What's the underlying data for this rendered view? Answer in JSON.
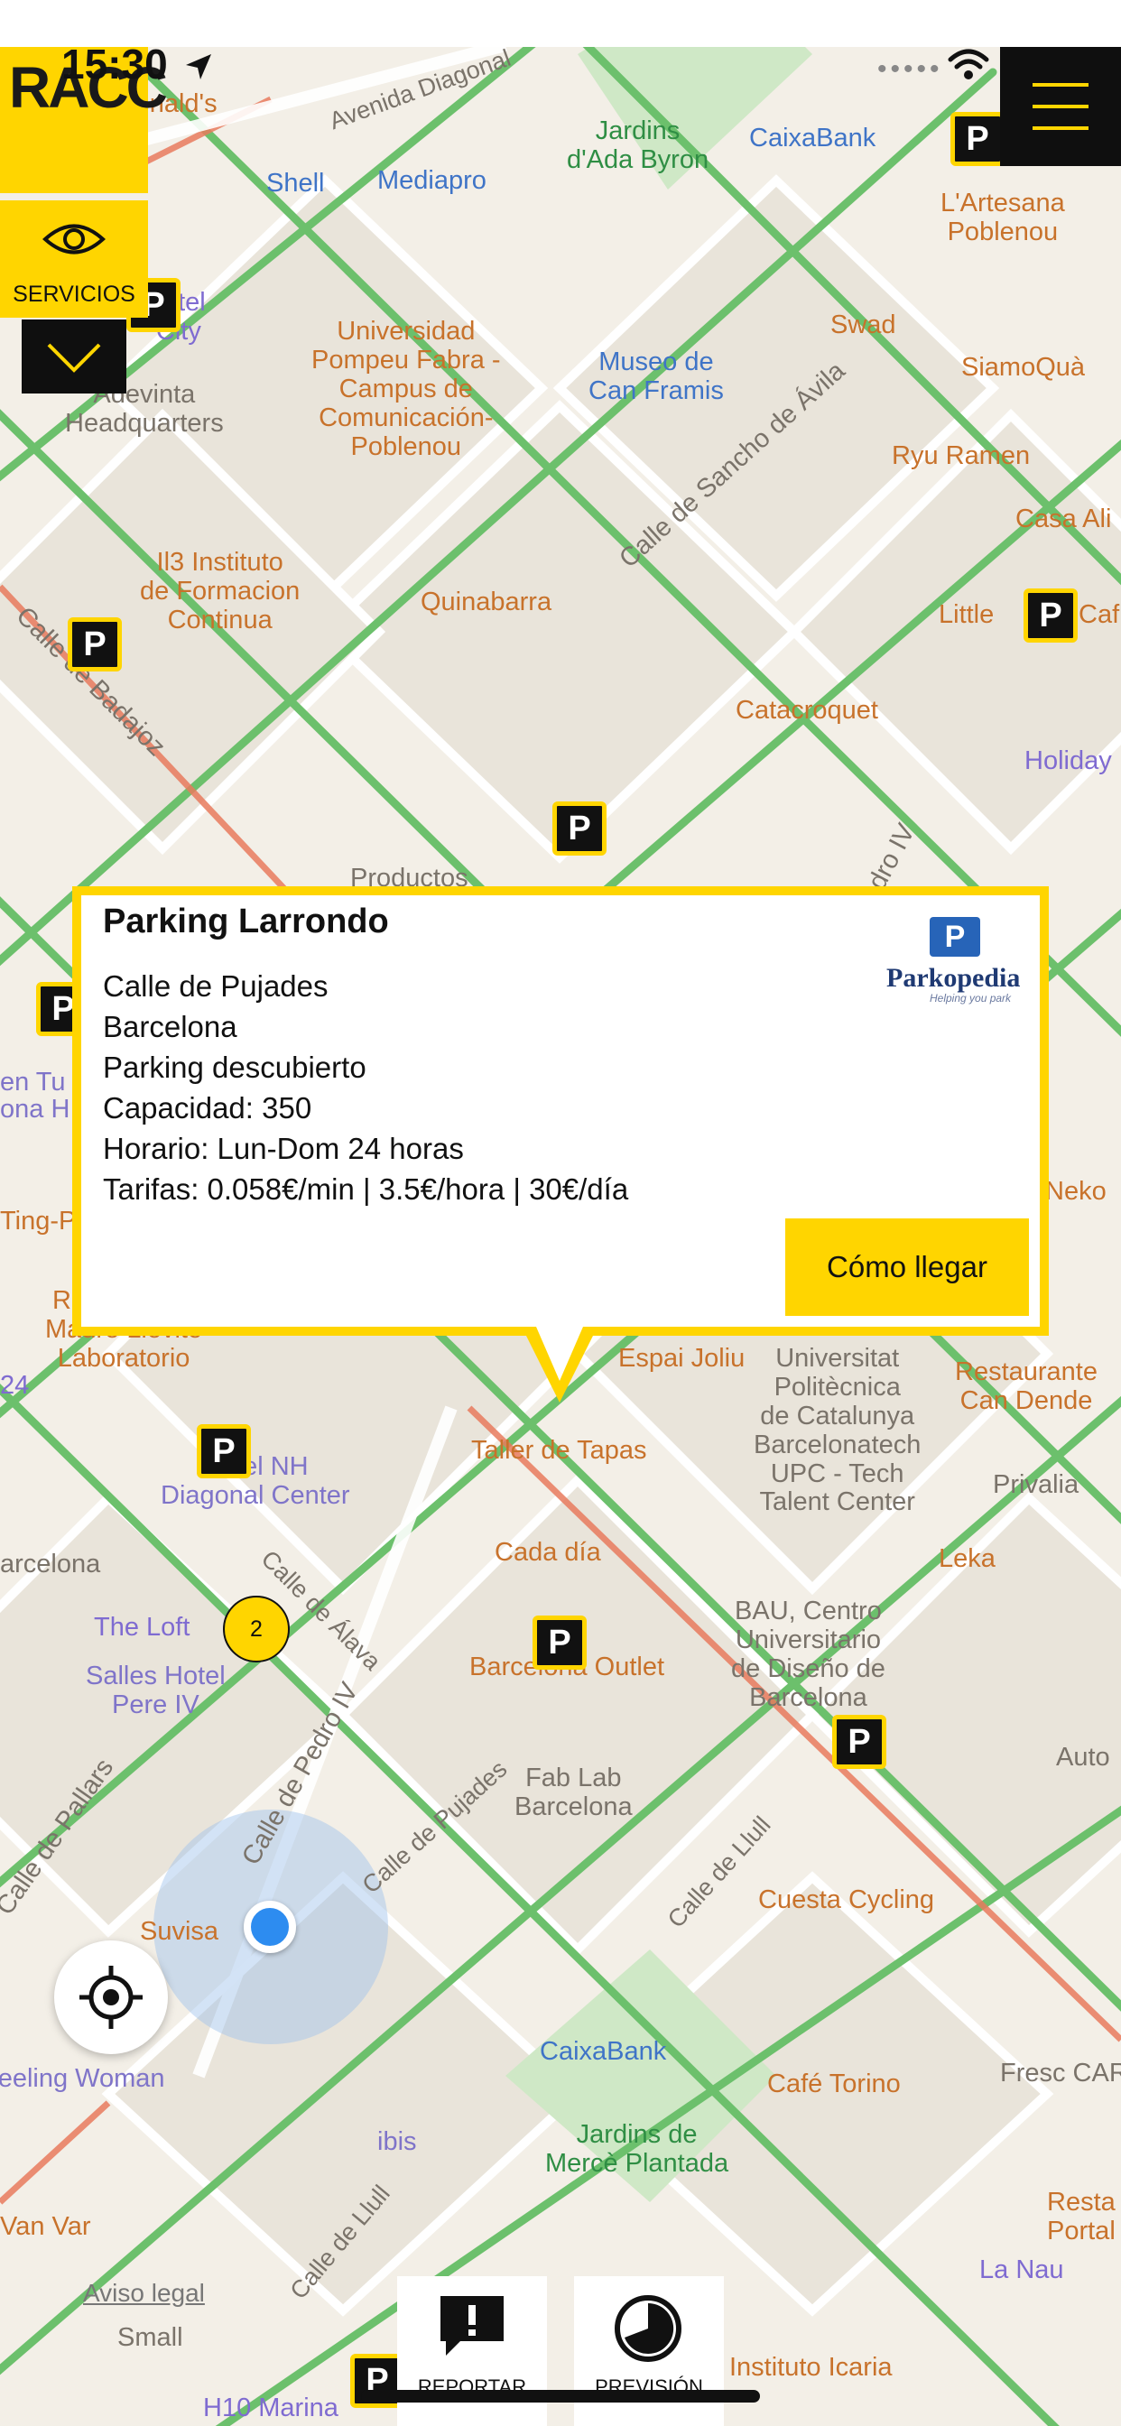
{
  "status": {
    "time": "15:30"
  },
  "header": {
    "logo_text": "RACC",
    "servicios_label": "SERVICIOS"
  },
  "map": {
    "labels": {
      "mcdonalds": "McDonald's",
      "avenida_diagonal": "Avenida Diagonal",
      "jardins_ada": "Jardins\nd'Ada Byron",
      "caixabank_top": "CaixaBank",
      "shell": "Shell",
      "mediapro": "Mediapro",
      "hotel_city": "Hotel\n City",
      "adevinta": "Adevinta\nHeadquarters",
      "universidad": "Universidad\nPompeu Fabra -\nCampus de\nComunicación-\nPoblenou",
      "museo": "Museo de\nCan Framis",
      "calle_sancho": "Calle de Sancho de Ávila",
      "lartesana": "L'Artesana\nPoblenou",
      "swad": "Swad",
      "siamoqua": "SiamoQuà",
      "ryu_ramen": "Ryu Ramen",
      "casa_ali": "Casa Ali",
      "il3": "Il3 Instituto\nde Formacion\nContinua",
      "quinabarra": "Quinabarra",
      "little": "Little",
      "caf": "Caf",
      "calle_badajoz": "Calle de Badajoz",
      "catacroquet": "Catacroquet",
      "holiday": "Holiday",
      "productos": "Productos",
      "calle_pedro_iv_top": "Calle de Pedro IV",
      "taller_tapas": "Taller de Tapas",
      "espai_joliu": "Espai Joliu",
      "upc": "Universitat\nPolitècnica\nde Catalunya\nBarcelonatech\nUPC - Tech\nTalent Center",
      "restaurante_can_dende": "Restaurante\nCan Dende",
      "restaurante_madre": "Restaurante\nMadre Lievito\nLaboratorio",
      "hotel_nh": "Hotel NH\nDiagonal Center",
      "privalia": "Privalia",
      "cada_dia": "Cada día",
      "leka": "Leka",
      "the_loft": "The Loft",
      "calle_alava": "Calle de Álava",
      "salles": "Salles Hotel\nPere IV",
      "barcelona_outlet": "Barcelona Outlet",
      "bau": "BAU, Centro\nUniversitario\nde Diseño de\nBarcelona",
      "auto": "Auto",
      "fab_lab": "Fab Lab\nBarcelona",
      "calle_pedro_iv_bottom": "Calle de Pedro IV",
      "calle_pallars": "Calle de Pallars",
      "calle_pujades": "Calle de Pujades",
      "calle_llull": "Calle de Llull",
      "cuesta": "Cuesta Cycling",
      "suvisa": "Suvisa",
      "caixabank_bottom": "CaixaBank",
      "fresc": "Fresc CAR",
      "cafe_torino": "Café Torino",
      "feeling": "Feeling Woman",
      "ibis": "ibis",
      "jardins_merce": "Jardins de\nMercè Plantada",
      "resta_portal": "Resta\nPortal",
      "van_var": "Van Var",
      "la_nau": "La Nau",
      "small": "Small",
      "calle_llull_bottom": "Calle de Llull",
      "instituto_icaria": "Instituto Icaria",
      "h10": "H10 Marina",
      "neko": "Neko",
      "fresc_left": "24",
      "arcelona": "arcelona",
      "ting_pot": "Ting-Pot Cafe",
      "en_tu": "en Tu",
      "ona_h": "ona H"
    },
    "cluster_count": "2"
  },
  "popup": {
    "title": "Parking Larrondo",
    "address": "Calle de Pujades",
    "city": "Barcelona",
    "type": "Parking descubierto",
    "capacity": "Capacidad: 350",
    "hours": "Horario: Lun-Dom 24 horas",
    "rates": "Tarifas: 0.058€/min | 3.5€/hora | 30€/día",
    "directions_label": "Cómo llegar",
    "provider": "Parkopedia",
    "provider_tagline": "Helping you park"
  },
  "footer": {
    "aviso_label": "Aviso legal",
    "report_label": "REPORTAR",
    "forecast_label": "PREVISIÓN"
  },
  "colors": {
    "accent": "#ffd500",
    "map_bg": "#f3efe7",
    "green_road": "#6cc06c",
    "red_road": "#e87a5d",
    "dark": "#0f0f0f",
    "location_blue": "#2d8cf0"
  },
  "icons": [
    "eye-icon",
    "chevron-down-icon",
    "hamburger-menu-icon",
    "location-arrow-icon",
    "wifi-icon",
    "crosshair-locate-icon",
    "report-icon",
    "forecast-icon",
    "parking-pin-icon"
  ]
}
